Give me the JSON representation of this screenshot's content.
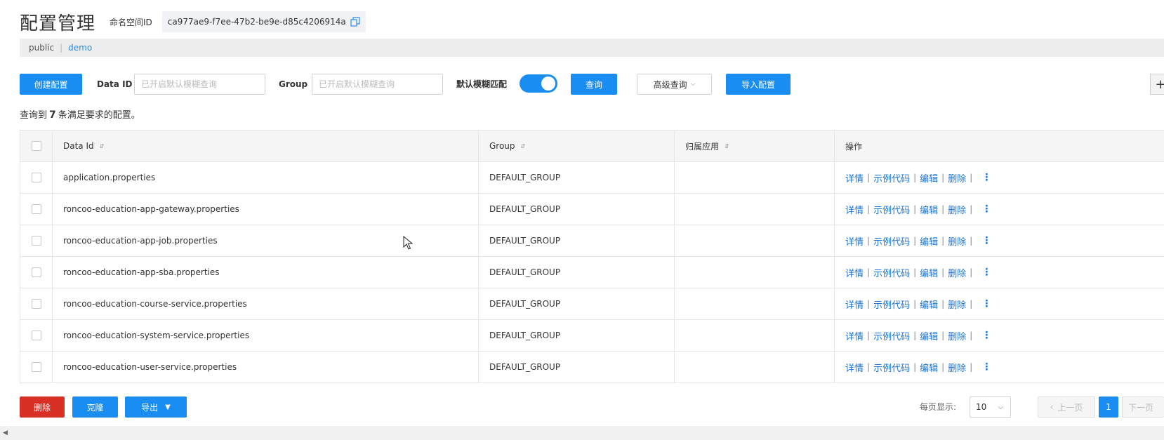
{
  "header": {
    "title": "配置管理",
    "namespace_label": "命名空间ID",
    "namespace_id": "ca977ae9-f7ee-47b2-be9e-d85c4206914a"
  },
  "namespace_bar": {
    "public": "public",
    "separator": "|",
    "demo": "demo"
  },
  "toolbar": {
    "create_label": "创建配置",
    "dataid_label": "Data ID",
    "dataid_placeholder": "已开启默认模糊查询",
    "group_label": "Group",
    "group_placeholder": "已开启默认模糊查询",
    "fuzzy_label": "默认模糊匹配",
    "fuzzy_enabled": true,
    "query_label": "查询",
    "advanced_label": "高级查询",
    "import_label": "导入配置",
    "edge_icon": "+"
  },
  "result": {
    "prefix": "查询到",
    "count": "7",
    "suffix": "条满足要求的配置。"
  },
  "table": {
    "headers": {
      "data_id": "Data Id",
      "group": "Group",
      "app": "归属应用",
      "ops": "操作"
    },
    "op_labels": {
      "detail": "详情",
      "sample": "示例代码",
      "edit": "编辑",
      "delete": "删除",
      "sep": "|"
    },
    "rows": [
      {
        "data_id": "application.properties",
        "group": "DEFAULT_GROUP",
        "app": ""
      },
      {
        "data_id": "roncoo-education-app-gateway.properties",
        "group": "DEFAULT_GROUP",
        "app": ""
      },
      {
        "data_id": "roncoo-education-app-job.properties",
        "group": "DEFAULT_GROUP",
        "app": ""
      },
      {
        "data_id": "roncoo-education-app-sba.properties",
        "group": "DEFAULT_GROUP",
        "app": ""
      },
      {
        "data_id": "roncoo-education-course-service.properties",
        "group": "DEFAULT_GROUP",
        "app": ""
      },
      {
        "data_id": "roncoo-education-system-service.properties",
        "group": "DEFAULT_GROUP",
        "app": ""
      },
      {
        "data_id": "roncoo-education-user-service.properties",
        "group": "DEFAULT_GROUP",
        "app": ""
      }
    ]
  },
  "footer": {
    "delete_label": "删除",
    "clone_label": "克隆",
    "export_label": "导出"
  },
  "pagination": {
    "page_size_label": "每页显示:",
    "page_size": "10",
    "prev_label": "上一页",
    "current_page": "1",
    "next_label": "下一页"
  },
  "colors": {
    "primary": "#1a8df2",
    "link": "#1a74d6",
    "danger": "#d93026"
  }
}
